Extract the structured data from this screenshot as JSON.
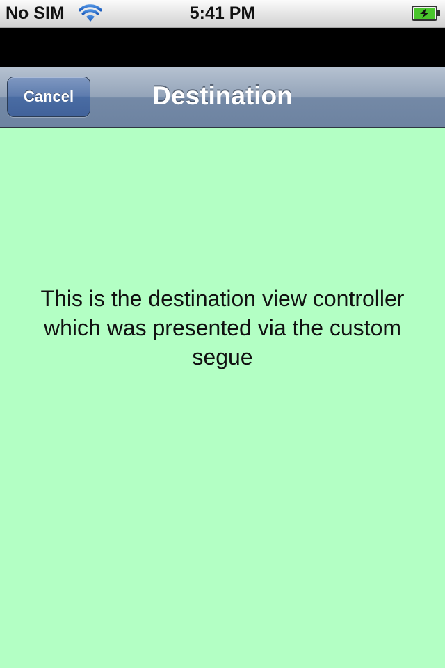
{
  "status_bar": {
    "carrier": "No SIM",
    "time": "5:41 PM",
    "wifi_icon": "wifi-icon",
    "battery_icon": "battery-charging-icon"
  },
  "nav_bar": {
    "cancel_label": "Cancel",
    "title": "Destination"
  },
  "content": {
    "message": "This is the destination view controller which was presented via the custom segue",
    "background_color": "#b3ffc4"
  },
  "colors": {
    "nav_bar": "#7489a6",
    "button": "#4a6ca3",
    "battery_fill": "#49c52c"
  }
}
